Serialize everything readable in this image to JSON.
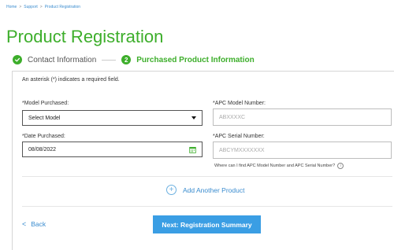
{
  "breadcrumb": {
    "items": [
      "Home",
      "Support",
      "Product Registration"
    ],
    "separator": ">"
  },
  "page": {
    "title": "Product Registration"
  },
  "steps": [
    {
      "label": "Contact Information",
      "status": "complete"
    },
    {
      "number": "2",
      "label": "Purchased Product Information",
      "status": "active"
    }
  ],
  "form": {
    "required_note": "An asterisk (*) indicates a required field.",
    "model_purchased": {
      "label": "*Model Purchased:",
      "value": "Select Model"
    },
    "apc_model_number": {
      "label": "*APC Model Number:",
      "placeholder": "ABXXXXC"
    },
    "date_purchased": {
      "label": "*Date Purchased:",
      "value": "08/08/2022"
    },
    "apc_serial_number": {
      "label": "*APC Serial Number:",
      "placeholder": "ABCYMXXXXXXX"
    },
    "help_text": "Where can I find APC Model Number and APC Serial Number?",
    "info_icon": "i",
    "add_another_label": "Add Another Product",
    "add_icon": "+"
  },
  "footer": {
    "back_label": "Back",
    "back_icon": "<",
    "next_label": "Next: Registration Summary"
  },
  "colors": {
    "brand_green": "#3dae2b",
    "link_blue": "#3a8ccf",
    "button_blue": "#3a9ee4"
  }
}
